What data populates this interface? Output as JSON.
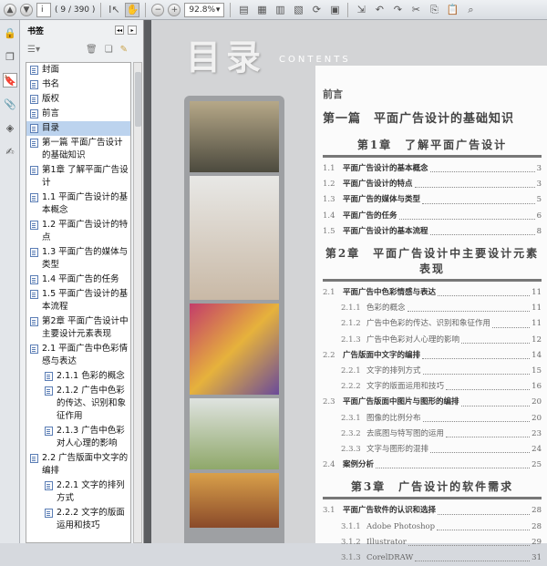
{
  "toolbar": {
    "page_input": "i",
    "page_count": "( 9 / 390 )",
    "zoom": "92.8%"
  },
  "panel": {
    "title": "书签"
  },
  "bookmarks": [
    {
      "label": "封面",
      "level": 0
    },
    {
      "label": "书名",
      "level": 0
    },
    {
      "label": "版权",
      "level": 0
    },
    {
      "label": "前言",
      "level": 0
    },
    {
      "label": "目录",
      "level": 0,
      "selected": true
    },
    {
      "label": "第一篇 平面广告设计的基础知识",
      "level": 0
    },
    {
      "label": "第1章 了解平面广告设计",
      "level": 0
    },
    {
      "label": "1.1 平面广告设计的基本概念",
      "level": 0
    },
    {
      "label": "1.2 平面广告设计的特点",
      "level": 0
    },
    {
      "label": "1.3 平面广告的媒体与类型",
      "level": 0
    },
    {
      "label": "1.4 平面广告的任务",
      "level": 0
    },
    {
      "label": "1.5 平面广告设计的基本流程",
      "level": 0
    },
    {
      "label": "第2章 平面广告设计中主要设计元素表现",
      "level": 0
    },
    {
      "label": "2.1 平面广告中色彩情感与表达",
      "level": 0
    },
    {
      "label": "2.1.1 色彩的概念",
      "level": 1
    },
    {
      "label": "2.1.2 广告中色彩的传达、识别和象征作用",
      "level": 1
    },
    {
      "label": "2.1.3 广告中色彩对人心理的影响",
      "level": 1
    },
    {
      "label": "2.2 广告版面中文字的编排",
      "level": 0
    },
    {
      "label": "2.2.1 文字的排列方式",
      "level": 1
    },
    {
      "label": "2.2.2 文字的版面运用和技巧",
      "level": 1
    }
  ],
  "page": {
    "title": "目录",
    "subtitle": "CONTENTS",
    "preface": "前言",
    "part": "第一篇　平面广告设计的基础知识",
    "chapters": [
      {
        "title": "第1章　了解平面广告设计",
        "entries": [
          {
            "num": "1.1",
            "text": "平面广告设计的基本概念",
            "page": "3",
            "level": 1
          },
          {
            "num": "1.2",
            "text": "平面广告设计的特点",
            "page": "3",
            "level": 1
          },
          {
            "num": "1.3",
            "text": "平面广告的媒体与类型",
            "page": "5",
            "level": 1
          },
          {
            "num": "1.4",
            "text": "平面广告的任务",
            "page": "6",
            "level": 1
          },
          {
            "num": "1.5",
            "text": "平面广告设计的基本流程",
            "page": "8",
            "level": 1
          }
        ]
      },
      {
        "title": "第2章　平面广告设计中主要设计元素表现",
        "entries": [
          {
            "num": "2.1",
            "text": "平面广告中色彩情感与表达",
            "page": "11",
            "level": 1
          },
          {
            "num": "2.1.1",
            "text": "色彩的概念",
            "page": "11",
            "level": 2
          },
          {
            "num": "2.1.2",
            "text": "广告中色彩的传达、识别和象征作用",
            "page": "11",
            "level": 2
          },
          {
            "num": "2.1.3",
            "text": "广告中色彩对人心理的影响",
            "page": "12",
            "level": 2
          },
          {
            "num": "2.2",
            "text": "广告版面中文字的编排",
            "page": "14",
            "level": 1
          },
          {
            "num": "2.2.1",
            "text": "文字的排列方式",
            "page": "15",
            "level": 2
          },
          {
            "num": "2.2.2",
            "text": "文字的版面运用和技巧",
            "page": "16",
            "level": 2
          },
          {
            "num": "2.3",
            "text": "平面广告版面中图片与图形的编排",
            "page": "20",
            "level": 1
          },
          {
            "num": "2.3.1",
            "text": "图像的比例分布",
            "page": "20",
            "level": 2
          },
          {
            "num": "2.3.2",
            "text": "去底图与特写图的运用",
            "page": "23",
            "level": 2
          },
          {
            "num": "2.3.3",
            "text": "文字与图形的混排",
            "page": "24",
            "level": 2
          },
          {
            "num": "2.4",
            "text": "案例分析",
            "page": "25",
            "level": 1
          }
        ]
      },
      {
        "title": "第3章　广告设计的软件需求",
        "entries": [
          {
            "num": "3.1",
            "text": "平面广告软件的认识和选择",
            "page": "28",
            "level": 1
          },
          {
            "num": "3.1.1",
            "text": "Adobe Photoshop",
            "page": "28",
            "level": 2
          },
          {
            "num": "3.1.2",
            "text": "Illustrator",
            "page": "29",
            "level": 2
          },
          {
            "num": "3.1.3",
            "text": "CorelDRAW",
            "page": "31",
            "level": 2
          }
        ]
      }
    ]
  }
}
